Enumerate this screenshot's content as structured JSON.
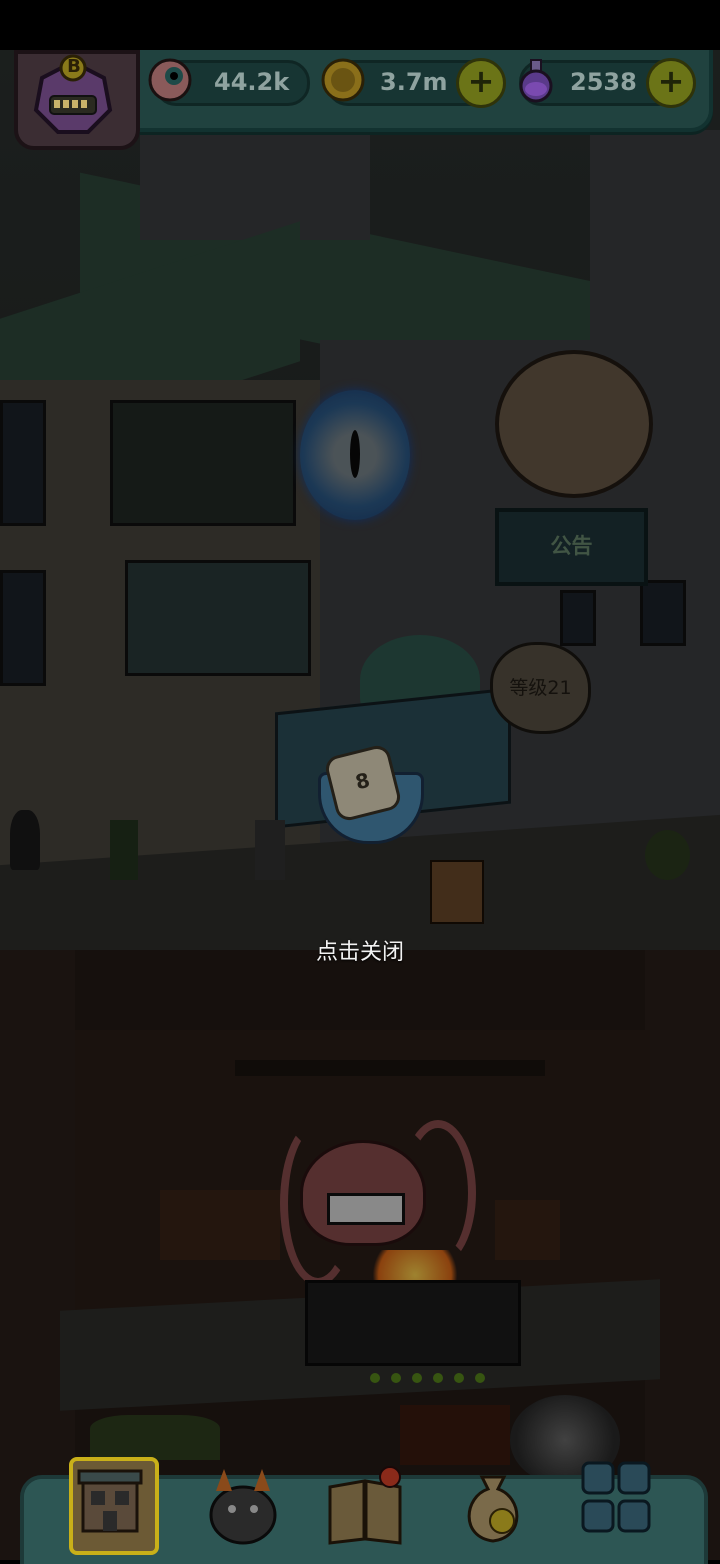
{
  "resources": {
    "eyes": {
      "value": "44.2k",
      "icon": "eyeball-icon"
    },
    "coins": {
      "value": "3.7m",
      "icon": "coin-icon",
      "add_label": "+"
    },
    "potions": {
      "value": "2538",
      "icon": "potion-icon",
      "add_label": "+"
    }
  },
  "avatar": {
    "badge": "B",
    "icon": "monster-avatar-icon"
  },
  "scene": {
    "notice_board": "公告",
    "level_bubble": "等级21",
    "dice_face": "8",
    "close_hint": "点击关闭"
  },
  "bottom_nav": [
    {
      "name": "building-tab",
      "icon": "building-icon",
      "active": true
    },
    {
      "name": "monster-tab",
      "icon": "monster-icon",
      "active": false
    },
    {
      "name": "book-tab",
      "icon": "book-icon",
      "active": false
    },
    {
      "name": "bag-tab",
      "icon": "money-bag-icon",
      "active": false
    },
    {
      "name": "grid-tab",
      "icon": "grid-icon",
      "active": false
    }
  ],
  "colors": {
    "panel": "#20423f",
    "accent_plus": "#6b7417",
    "hint_text": "#f2f2f2"
  }
}
